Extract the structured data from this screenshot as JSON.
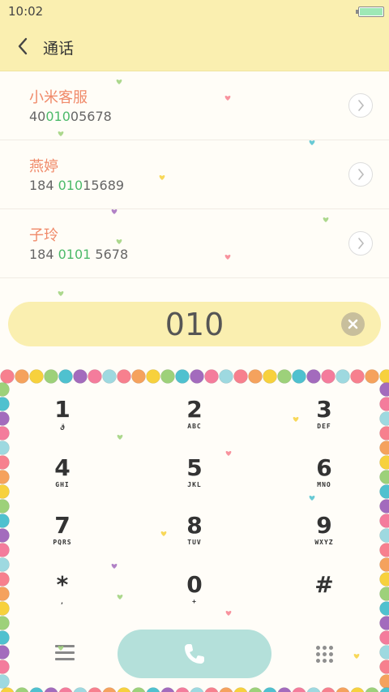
{
  "status_bar": {
    "time": "10:02"
  },
  "header": {
    "title": "通话"
  },
  "contacts": [
    {
      "name": "小米客服",
      "number_parts": [
        "40",
        "010",
        "05678"
      ]
    },
    {
      "name": "燕婷",
      "number_parts": [
        "184 ",
        "010",
        "15689"
      ]
    },
    {
      "name": "子玲",
      "number_parts": [
        "184 ",
        "0101",
        " 5678"
      ]
    }
  ],
  "dial_input": {
    "value": "010"
  },
  "keypad": [
    {
      "digit": "1",
      "letters": "ق"
    },
    {
      "digit": "2",
      "letters": "ABC"
    },
    {
      "digit": "3",
      "letters": "DEF"
    },
    {
      "digit": "4",
      "letters": "GHI"
    },
    {
      "digit": "5",
      "letters": "JKL"
    },
    {
      "digit": "6",
      "letters": "MNO"
    },
    {
      "digit": "7",
      "letters": "PQRS"
    },
    {
      "digit": "8",
      "letters": "TUV"
    },
    {
      "digit": "9",
      "letters": "WXYZ"
    },
    {
      "digit": "*",
      "letters": ","
    },
    {
      "digit": "0",
      "letters": "+"
    },
    {
      "digit": "#",
      "letters": ""
    }
  ],
  "icons": {
    "back": "back-arrow-icon",
    "contact_action": "chevron-right-icon",
    "clear": "clear-icon",
    "menu": "menu-icon",
    "call": "phone-icon",
    "dialpad": "dialpad-icon"
  },
  "colors": {
    "header_bg": "#faefb0",
    "contact_name": "#f08a6a",
    "match_highlight": "#4cba6a",
    "call_button": "#b4e0da",
    "bead_palette": [
      "#f7808e",
      "#f5a25d",
      "#f7d13d",
      "#9dd17a",
      "#4fc1cf",
      "#a36bbd",
      "#f47c9c",
      "#9ed9e0"
    ]
  }
}
